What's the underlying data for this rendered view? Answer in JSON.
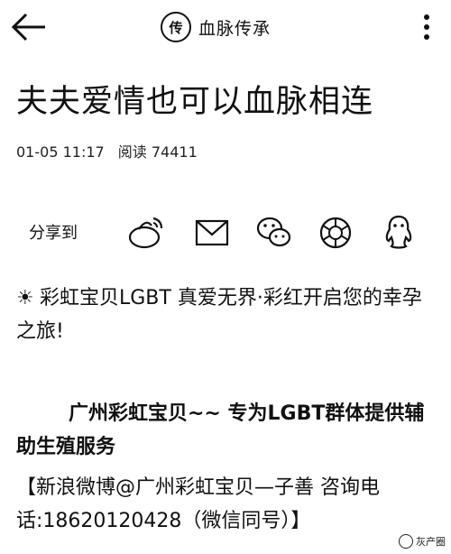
{
  "header": {
    "back_icon": "back-arrow-icon",
    "account_logo_text": "传",
    "account_name": "血脉传承",
    "more_icon": "more-vertical-icon"
  },
  "article": {
    "title": "夫夫爱情也可以血脉相连",
    "date": "01-05 11:17",
    "reads": "阅读 74411"
  },
  "share": {
    "label": "分享到",
    "icons": [
      "weibo-icon",
      "mail-icon",
      "wechat-icon",
      "moments-icon",
      "qq-icon"
    ]
  },
  "body": {
    "p1_sparkle": "☀",
    "p1": "彩虹宝贝LGBT  真爱无界·彩红开启您的幸孕之旅!",
    "p2": "广州彩虹宝贝~~ 专为LGBT群体提供辅助生殖服务",
    "p3": "【新浪微博@广州彩虹宝贝—子善  咨询电话:18620120428（微信同号）】"
  },
  "watermark": {
    "text": "灰产圈"
  }
}
